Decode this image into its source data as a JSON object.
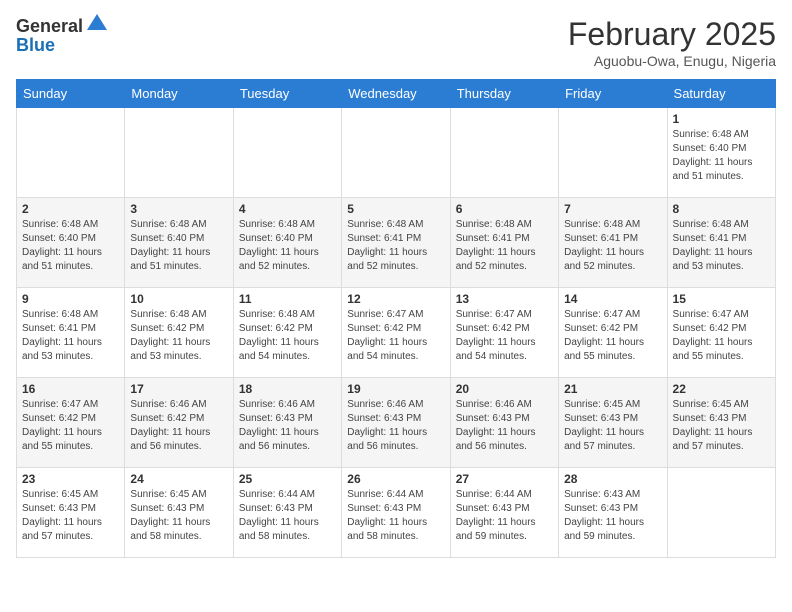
{
  "header": {
    "logo_general": "General",
    "logo_blue": "Blue",
    "month": "February 2025",
    "location": "Aguobu-Owa, Enugu, Nigeria"
  },
  "weekdays": [
    "Sunday",
    "Monday",
    "Tuesday",
    "Wednesday",
    "Thursday",
    "Friday",
    "Saturday"
  ],
  "weeks": [
    [
      null,
      null,
      null,
      null,
      null,
      null,
      {
        "day": "1",
        "sunrise": "6:48 AM",
        "sunset": "6:40 PM",
        "daylight": "11 hours and 51 minutes."
      }
    ],
    [
      {
        "day": "2",
        "sunrise": "6:48 AM",
        "sunset": "6:40 PM",
        "daylight": "11 hours and 51 minutes."
      },
      {
        "day": "3",
        "sunrise": "6:48 AM",
        "sunset": "6:40 PM",
        "daylight": "11 hours and 51 minutes."
      },
      {
        "day": "4",
        "sunrise": "6:48 AM",
        "sunset": "6:40 PM",
        "daylight": "11 hours and 52 minutes."
      },
      {
        "day": "5",
        "sunrise": "6:48 AM",
        "sunset": "6:41 PM",
        "daylight": "11 hours and 52 minutes."
      },
      {
        "day": "6",
        "sunrise": "6:48 AM",
        "sunset": "6:41 PM",
        "daylight": "11 hours and 52 minutes."
      },
      {
        "day": "7",
        "sunrise": "6:48 AM",
        "sunset": "6:41 PM",
        "daylight": "11 hours and 52 minutes."
      },
      {
        "day": "8",
        "sunrise": "6:48 AM",
        "sunset": "6:41 PM",
        "daylight": "11 hours and 53 minutes."
      }
    ],
    [
      {
        "day": "9",
        "sunrise": "6:48 AM",
        "sunset": "6:41 PM",
        "daylight": "11 hours and 53 minutes."
      },
      {
        "day": "10",
        "sunrise": "6:48 AM",
        "sunset": "6:42 PM",
        "daylight": "11 hours and 53 minutes."
      },
      {
        "day": "11",
        "sunrise": "6:48 AM",
        "sunset": "6:42 PM",
        "daylight": "11 hours and 54 minutes."
      },
      {
        "day": "12",
        "sunrise": "6:47 AM",
        "sunset": "6:42 PM",
        "daylight": "11 hours and 54 minutes."
      },
      {
        "day": "13",
        "sunrise": "6:47 AM",
        "sunset": "6:42 PM",
        "daylight": "11 hours and 54 minutes."
      },
      {
        "day": "14",
        "sunrise": "6:47 AM",
        "sunset": "6:42 PM",
        "daylight": "11 hours and 55 minutes."
      },
      {
        "day": "15",
        "sunrise": "6:47 AM",
        "sunset": "6:42 PM",
        "daylight": "11 hours and 55 minutes."
      }
    ],
    [
      {
        "day": "16",
        "sunrise": "6:47 AM",
        "sunset": "6:42 PM",
        "daylight": "11 hours and 55 minutes."
      },
      {
        "day": "17",
        "sunrise": "6:46 AM",
        "sunset": "6:42 PM",
        "daylight": "11 hours and 56 minutes."
      },
      {
        "day": "18",
        "sunrise": "6:46 AM",
        "sunset": "6:43 PM",
        "daylight": "11 hours and 56 minutes."
      },
      {
        "day": "19",
        "sunrise": "6:46 AM",
        "sunset": "6:43 PM",
        "daylight": "11 hours and 56 minutes."
      },
      {
        "day": "20",
        "sunrise": "6:46 AM",
        "sunset": "6:43 PM",
        "daylight": "11 hours and 56 minutes."
      },
      {
        "day": "21",
        "sunrise": "6:45 AM",
        "sunset": "6:43 PM",
        "daylight": "11 hours and 57 minutes."
      },
      {
        "day": "22",
        "sunrise": "6:45 AM",
        "sunset": "6:43 PM",
        "daylight": "11 hours and 57 minutes."
      }
    ],
    [
      {
        "day": "23",
        "sunrise": "6:45 AM",
        "sunset": "6:43 PM",
        "daylight": "11 hours and 57 minutes."
      },
      {
        "day": "24",
        "sunrise": "6:45 AM",
        "sunset": "6:43 PM",
        "daylight": "11 hours and 58 minutes."
      },
      {
        "day": "25",
        "sunrise": "6:44 AM",
        "sunset": "6:43 PM",
        "daylight": "11 hours and 58 minutes."
      },
      {
        "day": "26",
        "sunrise": "6:44 AM",
        "sunset": "6:43 PM",
        "daylight": "11 hours and 58 minutes."
      },
      {
        "day": "27",
        "sunrise": "6:44 AM",
        "sunset": "6:43 PM",
        "daylight": "11 hours and 59 minutes."
      },
      {
        "day": "28",
        "sunrise": "6:43 AM",
        "sunset": "6:43 PM",
        "daylight": "11 hours and 59 minutes."
      },
      null
    ]
  ]
}
